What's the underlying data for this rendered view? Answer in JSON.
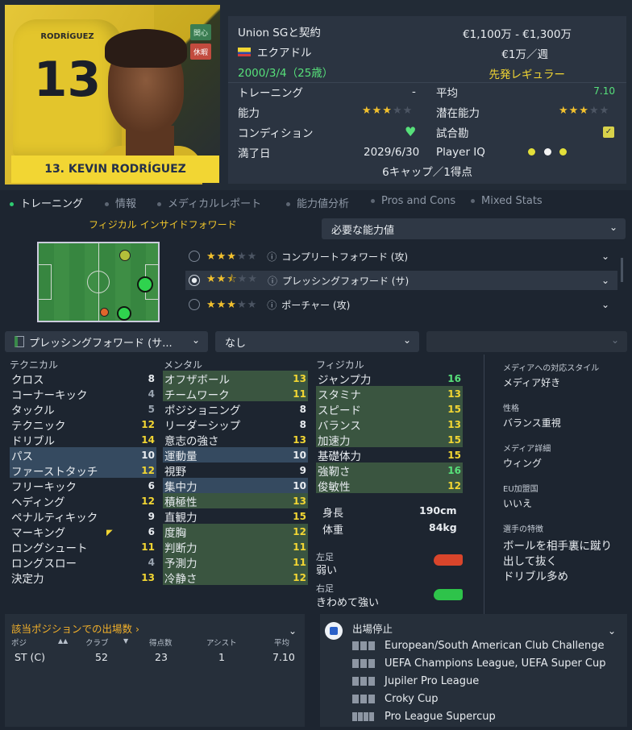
{
  "player": {
    "shirt_name": "RODRÍGUEZ",
    "number": "13",
    "banner": "13. KEVIN RODRÍGUEZ",
    "tags": [
      "関心",
      "休暇"
    ]
  },
  "info": {
    "contract_label": "Union SGと契約",
    "value_range": "€1,100万 - €1,300万",
    "nation": "エクアドル",
    "wage": "€1万／週",
    "birth": "2000/3/4（25歳）",
    "squad_status": "先発レギュラー",
    "training_label": "トレーニング",
    "training_value": "-",
    "average_label": "平均",
    "average_value": "7.10",
    "ability_label": "能力",
    "potential_label": "潜在能力",
    "condition_label": "コンディション",
    "match_fitness_label": "試合勘",
    "contract_end_label": "満了日",
    "contract_end": "2029/6/30",
    "iq_label": "Player IQ",
    "caps": "6キャップ／1得点",
    "ability_stars": 3,
    "potential_stars": 3
  },
  "tabs": [
    "トレーニング",
    "情報",
    "メディカルレポート",
    "能力値分析",
    "Pros and Cons",
    "Mixed Stats"
  ],
  "role_heading": "フィジカル インサイドフォワード",
  "required_attrs": "必要な能力値",
  "roles": [
    {
      "name": "コンプリートフォワード (攻)",
      "stars": 3
    },
    {
      "name": "プレッシングフォワード (サ)",
      "stars": 2.5
    },
    {
      "name": "ポーチャー (攻)",
      "stars": 3
    }
  ],
  "selectors": {
    "role": "プレッシングフォワード (サ...",
    "compare": "なし",
    "extra": ""
  },
  "columns": {
    "technical": "テクニカル",
    "mental": "メンタル",
    "physical": "フィジカル"
  },
  "technical": [
    {
      "name": "クロス",
      "value": "8",
      "color": "wht",
      "hl": ""
    },
    {
      "name": "コーナーキック",
      "value": "4",
      "color": "grey",
      "hl": ""
    },
    {
      "name": "タックル",
      "value": "5",
      "color": "grey",
      "hl": ""
    },
    {
      "name": "テクニック",
      "value": "12",
      "color": "yel",
      "hl": ""
    },
    {
      "name": "ドリブル",
      "value": "14",
      "color": "yel",
      "hl": ""
    },
    {
      "name": "パス",
      "value": "10",
      "color": "wht",
      "hl": "hl"
    },
    {
      "name": "ファーストタッチ",
      "value": "12",
      "color": "yel",
      "hl": "hl"
    },
    {
      "name": "フリーキック",
      "value": "6",
      "color": "wht",
      "hl": ""
    },
    {
      "name": "ヘディング",
      "value": "12",
      "color": "yel",
      "hl": ""
    },
    {
      "name": "ペナルティキック",
      "value": "9",
      "color": "wht",
      "hl": ""
    },
    {
      "name": "マーキング",
      "value": "6",
      "color": "wht",
      "hl": ""
    },
    {
      "name": "ロングシュート",
      "value": "11",
      "color": "yel",
      "hl": ""
    },
    {
      "name": "ロングスロー",
      "value": "4",
      "color": "grey",
      "hl": ""
    },
    {
      "name": "決定力",
      "value": "13",
      "color": "yel",
      "hl": ""
    }
  ],
  "mental": [
    {
      "name": "オフザボール",
      "value": "13",
      "color": "yel",
      "hl": "hl"
    },
    {
      "name": "チームワーク",
      "value": "11",
      "color": "yel",
      "hl": "hl"
    },
    {
      "name": "ポジショニング",
      "value": "8",
      "color": "wht",
      "hl": ""
    },
    {
      "name": "リーダーシップ",
      "value": "8",
      "color": "wht",
      "hl": ""
    },
    {
      "name": "意志の強さ",
      "value": "13",
      "color": "yel",
      "hl": ""
    },
    {
      "name": "運動量",
      "value": "10",
      "color": "wht",
      "hl": "hl"
    },
    {
      "name": "視野",
      "value": "9",
      "color": "wht",
      "hl": ""
    },
    {
      "name": "集中力",
      "value": "10",
      "color": "wht",
      "hl": "hl"
    },
    {
      "name": "積極性",
      "value": "13",
      "color": "yel",
      "hl": "hl"
    },
    {
      "name": "直観力",
      "value": "15",
      "color": "yel",
      "hl": ""
    },
    {
      "name": "度胸",
      "value": "12",
      "color": "yel",
      "hl": "hl"
    },
    {
      "name": "判断力",
      "value": "11",
      "color": "yel",
      "hl": "hl"
    },
    {
      "name": "予測力",
      "value": "11",
      "color": "yel",
      "hl": "hl"
    },
    {
      "name": "冷静さ",
      "value": "12",
      "color": "yel",
      "hl": "hl"
    }
  ],
  "physical": [
    {
      "name": "ジャンプ力",
      "value": "16",
      "color": "grn",
      "hl": ""
    },
    {
      "name": "スタミナ",
      "value": "13",
      "color": "yel",
      "hl": "hl"
    },
    {
      "name": "スピード",
      "value": "15",
      "color": "yel",
      "hl": "hl"
    },
    {
      "name": "バランス",
      "value": "13",
      "color": "yel",
      "hl": "hl"
    },
    {
      "name": "加速力",
      "value": "15",
      "color": "yel",
      "hl": "hl"
    },
    {
      "name": "基礎体力",
      "value": "15",
      "color": "yel",
      "hl": ""
    },
    {
      "name": "強靭さ",
      "value": "16",
      "color": "grn",
      "hl": "hl"
    },
    {
      "name": "俊敏性",
      "value": "12",
      "color": "yel",
      "hl": "hl"
    }
  ],
  "body": {
    "height_label": "身長",
    "height": "190cm",
    "weight_label": "体重",
    "weight": "84kg"
  },
  "feet": {
    "left_label": "左足",
    "left": "弱い",
    "right_label": "右足",
    "right": "きわめて強い"
  },
  "side": {
    "media_style_label": "メディアへの対応スタイル",
    "media_style": "メディア好き",
    "personality_label": "性格",
    "personality": "バランス重視",
    "media_detail_label": "メディア詳細",
    "media_detail": "ウィング",
    "eu_label": "EU加盟国",
    "eu": "いいえ",
    "traits_label": "選手の特徴",
    "traits": [
      "ボールを相手裏に蹴り",
      "出して抜く",
      "ドリブル多め"
    ]
  },
  "apps": {
    "title": "該当ポジションでの出場数 ›",
    "headers": [
      "ポジ",
      "クラブ",
      "得点数",
      "アシスト",
      "平均"
    ],
    "row": [
      "ST (C)",
      "52",
      "23",
      "1",
      "7.10"
    ]
  },
  "suspension": {
    "title": "出場停止",
    "items": [
      {
        "name": "European/South American Club Challenge",
        "bars": 3
      },
      {
        "name": "UEFA Champions League, UEFA Super Cup",
        "bars": 3
      },
      {
        "name": "Jupiler Pro League",
        "bars": 3
      },
      {
        "name": "Croky Cup",
        "bars": 3
      },
      {
        "name": "Pro League Supercup",
        "bars": 4
      }
    ]
  },
  "colors": {
    "accent": "#f2d633",
    "green": "#57e07a",
    "highlight": "#354a60"
  }
}
